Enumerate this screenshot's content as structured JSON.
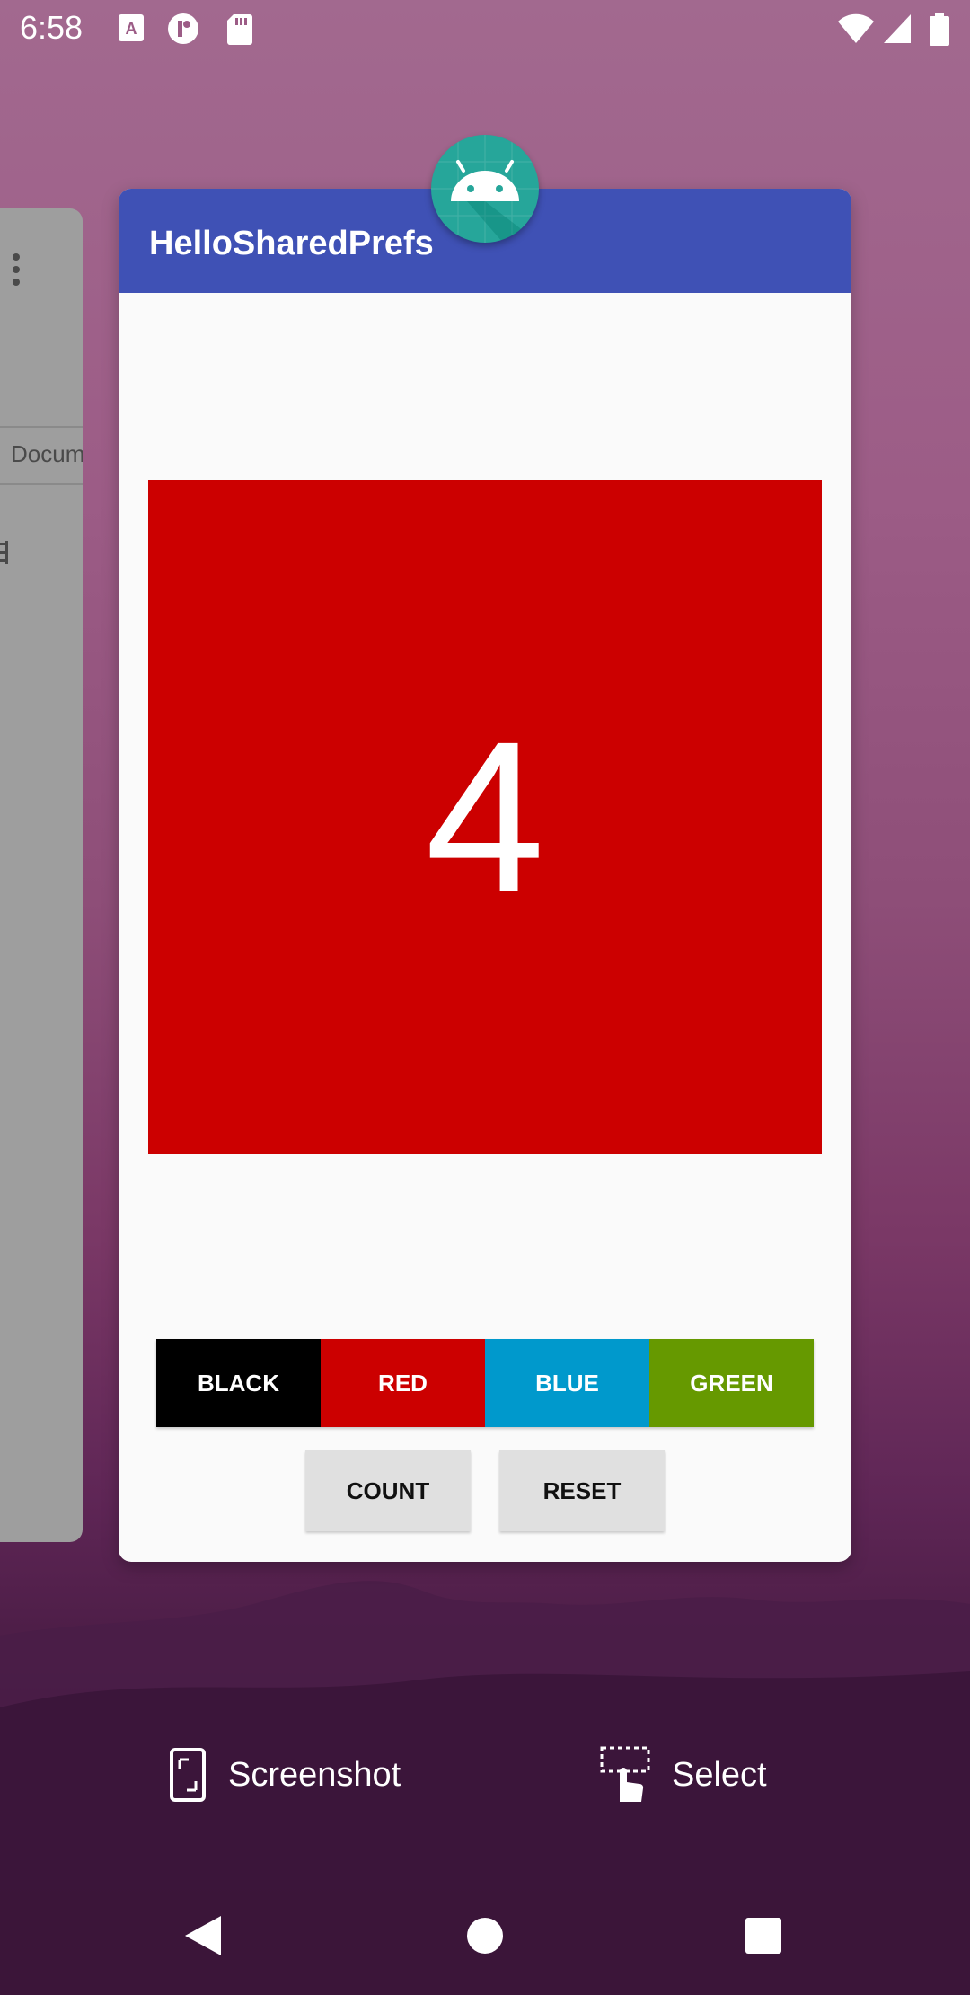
{
  "status_bar": {
    "time": "6:58",
    "icons": [
      "text-a-icon",
      "notification-icon",
      "sd-card-icon",
      "wifi-icon",
      "signal-icon",
      "battery-icon"
    ]
  },
  "background_app": {
    "label": "Docum",
    "icons": [
      "overflow-menu-icon",
      "list-icon"
    ]
  },
  "app_card": {
    "title": "HelloSharedPrefs",
    "app_icon": "android-icon",
    "count": "4",
    "count_bg_color": "#cc0000",
    "color_buttons": [
      {
        "label": "BLACK",
        "color": "#000000"
      },
      {
        "label": "RED",
        "color": "#cc0000"
      },
      {
        "label": "BLUE",
        "color": "#0099cc"
      },
      {
        "label": "GREEN",
        "color": "#669900"
      }
    ],
    "count_button": "COUNT",
    "reset_button": "RESET"
  },
  "actions": {
    "screenshot": "Screenshot",
    "select": "Select"
  },
  "nav": {
    "icons": [
      "back-icon",
      "home-icon",
      "recents-icon"
    ]
  },
  "colors": {
    "app_bar": "#3f51b5",
    "accent_teal": "#26a69a"
  }
}
